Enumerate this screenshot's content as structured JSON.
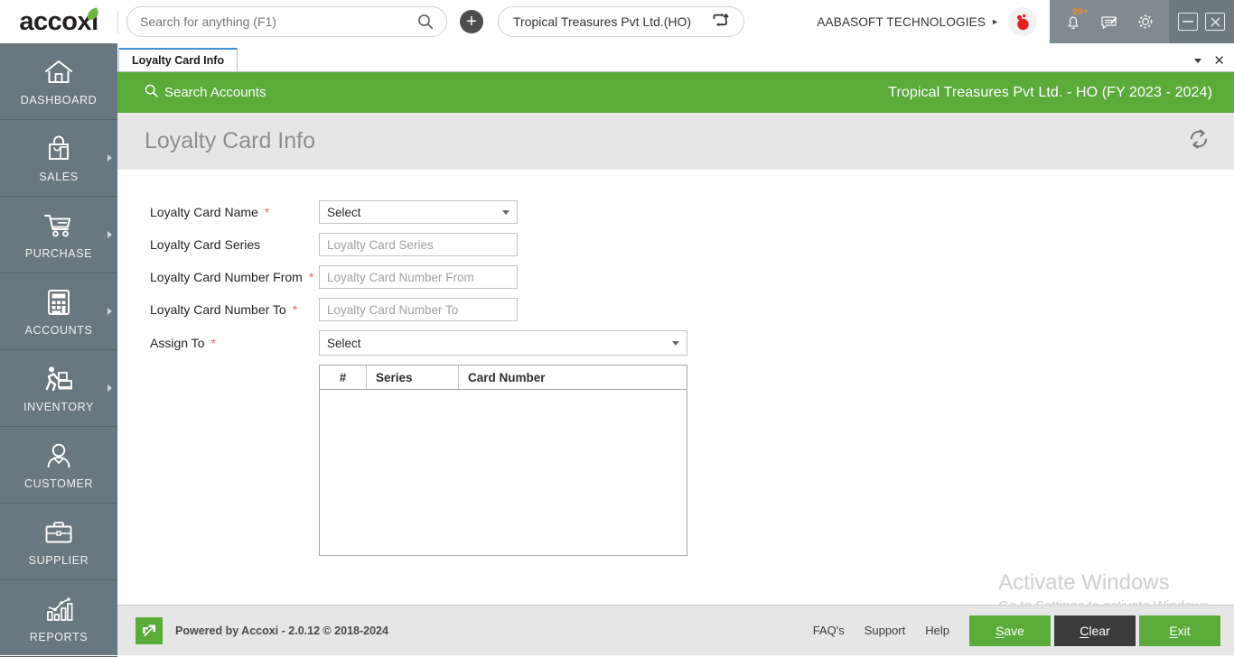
{
  "app": {
    "logo_text": "accoxi"
  },
  "topbar": {
    "search_placeholder": "Search for anything (F1)",
    "search_value": "",
    "add_label": "+",
    "branch": "Tropical Treasures Pvt Ltd.(HO)",
    "company": "AABASOFT TECHNOLOGIES",
    "notification_badge": "99+"
  },
  "sidebar": {
    "items": [
      {
        "label": "DASHBOARD",
        "icon": "home-icon",
        "has_arrow": false
      },
      {
        "label": "SALES",
        "icon": "shopping-bag-icon",
        "has_arrow": true
      },
      {
        "label": "PURCHASE",
        "icon": "shopping-cart-icon",
        "has_arrow": true
      },
      {
        "label": "ACCOUNTS",
        "icon": "calculator-icon",
        "has_arrow": true
      },
      {
        "label": "INVENTORY",
        "icon": "warehouse-worker-icon",
        "has_arrow": true
      },
      {
        "label": "CUSTOMER",
        "icon": "person-icon",
        "has_arrow": false
      },
      {
        "label": "SUPPLIER",
        "icon": "briefcase-icon",
        "has_arrow": false
      },
      {
        "label": "REPORTS",
        "icon": "bar-chart-icon",
        "has_arrow": false
      }
    ]
  },
  "tabs": [
    {
      "label": "Loyalty Card Info",
      "active": true
    }
  ],
  "greenbar": {
    "search_accounts": "Search Accounts",
    "company_fy": "Tropical Treasures Pvt Ltd. - HO (FY 2023 - 2024)"
  },
  "page": {
    "title": "Loyalty Card Info"
  },
  "form": {
    "fields": [
      {
        "label": "Loyalty Card Name",
        "required": true,
        "type": "select",
        "value": "Select",
        "placeholder": "",
        "width": "w220"
      },
      {
        "label": "Loyalty Card Series",
        "required": false,
        "type": "text",
        "value": "",
        "placeholder": "Loyalty Card Series",
        "width": "w220"
      },
      {
        "label": "Loyalty Card Number From",
        "required": true,
        "type": "text",
        "value": "",
        "placeholder": "Loyalty Card Number From",
        "width": "w220"
      },
      {
        "label": "Loyalty Card Number To",
        "required": true,
        "type": "text",
        "value": "",
        "placeholder": "Loyalty Card Number To",
        "width": "w220"
      },
      {
        "label": "Assign To",
        "required": true,
        "type": "select",
        "value": "Select",
        "placeholder": "",
        "width": "w408"
      }
    ]
  },
  "grid": {
    "columns": [
      "#",
      "Series",
      "Card Number"
    ],
    "rows": []
  },
  "watermark": {
    "line1": "Activate Windows",
    "line2": "Go to Settings to activate Windows."
  },
  "footer": {
    "powered_by": "Powered by Accoxi - 2.0.12 © 2018-2024",
    "links": [
      "FAQ's",
      "Support",
      "Help"
    ],
    "buttons": [
      {
        "label": "Save",
        "accel": "S",
        "style": "green"
      },
      {
        "label": "Clear",
        "accel": "C",
        "style": "dark"
      },
      {
        "label": "Exit",
        "accel": "E",
        "style": "green"
      }
    ]
  },
  "colors": {
    "brand_green": "#5aab3a",
    "sidebar": "#697780",
    "tray": "#808a91",
    "required_red": "#e8645a",
    "badge_orange": "#f08b2a",
    "tab_accent": "#3f8fd6"
  }
}
